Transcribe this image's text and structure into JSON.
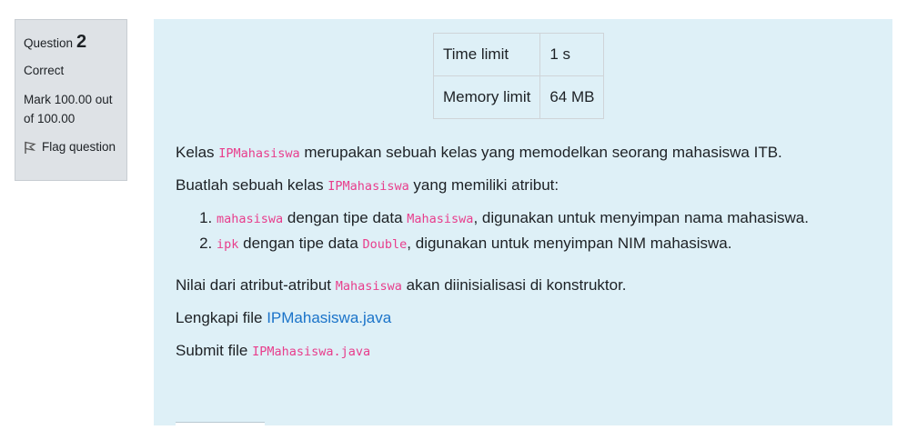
{
  "info": {
    "question_label": "Question",
    "question_number": "2",
    "state": "Correct",
    "grade": "Mark 100.00 out of 100.00",
    "flag_label": "Flag question"
  },
  "limits": [
    {
      "label": "Time limit",
      "value": "1 s"
    },
    {
      "label": "Memory limit",
      "value": "64 MB"
    }
  ],
  "prose": {
    "p1": {
      "before": "Kelas ",
      "code": "IPMahasiswa",
      "after": " merupakan sebuah kelas yang memodelkan seorang mahasiswa ITB."
    },
    "p2": {
      "before": "Buatlah sebuah kelas ",
      "code": "IPMahasiswa",
      "after": " yang memiliki atribut:"
    },
    "items": [
      {
        "code": "mahasiswa",
        "mid": " dengan tipe data ",
        "type": "Mahasiswa",
        "after": ", digunakan untuk menyimpan nama mahasiswa."
      },
      {
        "code": "ipk",
        "mid": " dengan tipe data ",
        "type": "Double",
        "after": ", digunakan untuk menyimpan NIM mahasiswa."
      }
    ],
    "p3": {
      "before": "Nilai dari atribut-atribut ",
      "code": "Mahasiswa",
      "after": " akan diinisialisasi di konstruktor."
    },
    "p4": {
      "before": "Lengkapi file ",
      "link": "IPMahasiswa.java"
    },
    "p5": {
      "before": "Submit file ",
      "code": "IPMahasiswa.java"
    }
  },
  "colors": {
    "code": "#e83e8c",
    "link": "#1a73c9",
    "content_bg": "#def0f7",
    "info_bg": "#dee2e6"
  }
}
